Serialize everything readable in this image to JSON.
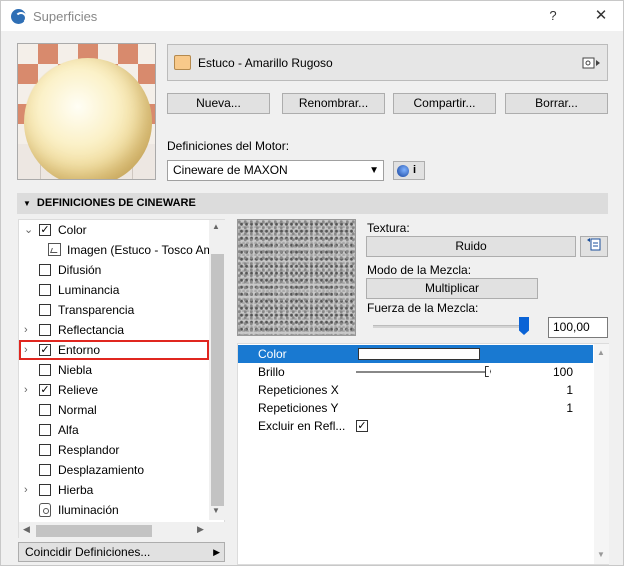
{
  "window": {
    "title": "Superficies",
    "help_glyph": "?",
    "close_glyph": "✕"
  },
  "material": {
    "name": "Estuco - Amarillo Rugoso",
    "swatch_color": "#f8c98a"
  },
  "buttons": {
    "new": "Nueva...",
    "rename": "Renombrar...",
    "share": "Compartir...",
    "delete": "Borrar..."
  },
  "engine": {
    "label": "Definiciones del Motor:",
    "selected": "Cineware de MAXON",
    "info": "i"
  },
  "section": {
    "title": "DEFINICIONES DE CINEWARE"
  },
  "channels": [
    {
      "label": "Color",
      "checked": "✓",
      "expand": "⌄"
    },
    {
      "label": "Imagen (Estuco - Tosco Amarillo)"
    },
    {
      "label": "Difusión"
    },
    {
      "label": "Luminancia"
    },
    {
      "label": "Transparencia"
    },
    {
      "label": "Reflectancia",
      "expand": "›"
    },
    {
      "label": "Entorno",
      "checked": "✓",
      "expand": "›"
    },
    {
      "label": "Niebla"
    },
    {
      "label": "Relieve",
      "checked": "✓",
      "expand": "›"
    },
    {
      "label": "Normal"
    },
    {
      "label": "Alfa"
    },
    {
      "label": "Resplandor"
    },
    {
      "label": "Desplazamiento"
    },
    {
      "label": "Hierba",
      "expand": "›"
    },
    {
      "label": "Iluminación"
    }
  ],
  "match_button": "Coincidir Definiciones...",
  "texture": {
    "label": "Textura:",
    "value": "Ruido",
    "blend_mode_label": "Modo de la Mezcla:",
    "blend_mode": "Multiplicar",
    "blend_strength_label": "Fuerza de la Mezcla:",
    "blend_strength": "100,00",
    "blend_strength_level": 1.0
  },
  "properties": [
    {
      "label": "Color",
      "value": ""
    },
    {
      "label": "Brillo",
      "value": "100"
    },
    {
      "label": "Repeticiones X",
      "value": "1"
    },
    {
      "label": "Repeticiones Y",
      "value": "1"
    },
    {
      "label": "Excluir en Refl...",
      "value": "✓"
    }
  ],
  "colors": {
    "accent": "#1979d1",
    "selection_outline": "#e0261f"
  }
}
